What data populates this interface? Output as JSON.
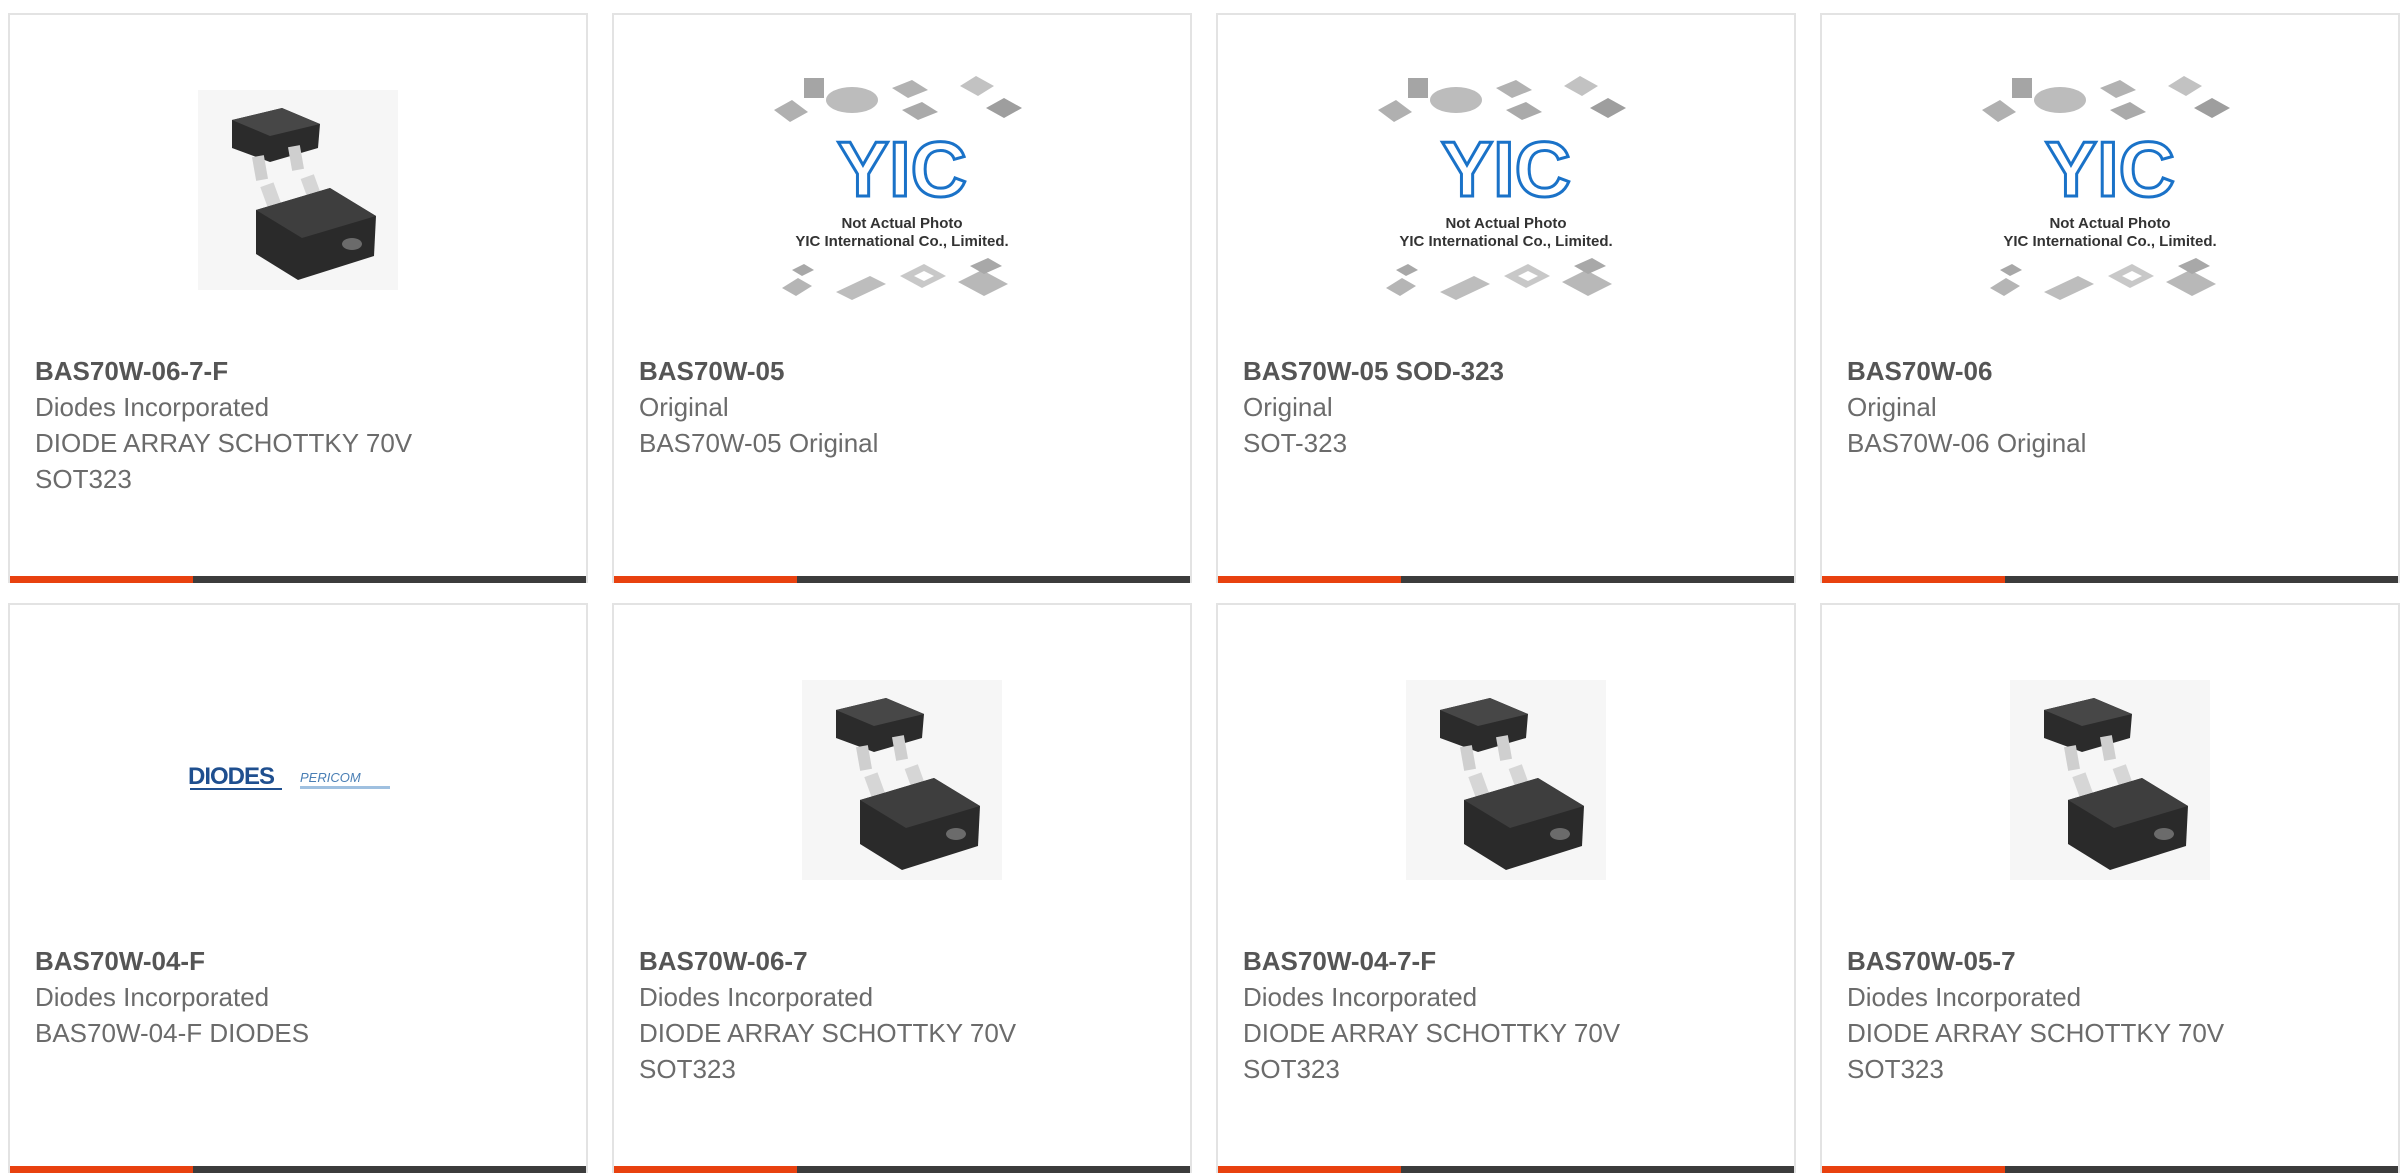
{
  "products": [
    {
      "part": "BAS70W-06-7-F",
      "maker": "Diodes Incorporated",
      "desc": "DIODE ARRAY SCHOTTKY 70V",
      "package": "SOT323",
      "image": "sot323-photo"
    },
    {
      "part": "BAS70W-05",
      "maker": "Original",
      "desc": "BAS70W-05 Original",
      "package": "",
      "image": "yic-placeholder"
    },
    {
      "part": "BAS70W-05 SOD-323",
      "maker": "Original",
      "desc": "SOT-323",
      "package": "",
      "image": "yic-placeholder"
    },
    {
      "part": "BAS70W-06",
      "maker": "Original",
      "desc": "BAS70W-06 Original",
      "package": "",
      "image": "yic-placeholder"
    },
    {
      "part": "BAS70W-04-F",
      "maker": "Diodes Incorporated",
      "desc": "BAS70W-04-F DIODES",
      "package": "",
      "image": "diodes-logo"
    },
    {
      "part": "BAS70W-06-7",
      "maker": "Diodes Incorporated",
      "desc": "DIODE ARRAY SCHOTTKY 70V",
      "package": "SOT323",
      "image": "sot323-photo"
    },
    {
      "part": "BAS70W-04-7-F",
      "maker": "Diodes Incorporated",
      "desc": "DIODE ARRAY SCHOTTKY 70V",
      "package": "SOT323",
      "image": "sot323-photo"
    },
    {
      "part": "BAS70W-05-7",
      "maker": "Diodes Incorporated",
      "desc": "DIODE ARRAY SCHOTTKY 70V",
      "package": "SOT323",
      "image": "sot323-photo"
    }
  ],
  "placeholder": {
    "logo": "YIC",
    "line1": "Not Actual Photo",
    "line2": "YIC International Co., Limited."
  },
  "brand_logo": {
    "primary": "DIODES",
    "secondary": "PERICOM"
  },
  "colors": {
    "accent": "#e8410f",
    "bar": "#3c3c3c",
    "title": "#555555",
    "text": "#6b6b6b"
  }
}
